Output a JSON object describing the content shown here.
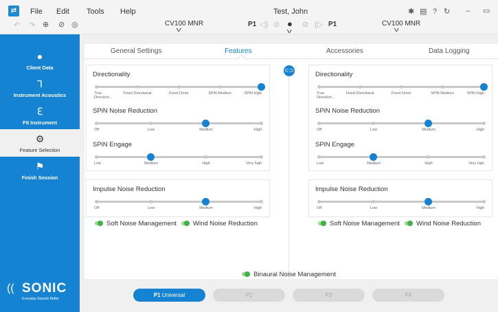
{
  "menu": {
    "file": "File",
    "edit": "Edit",
    "tools": "Tools",
    "help": "Help"
  },
  "patient": "Test, John",
  "devices": {
    "left": "CV100 MNR",
    "right": "CV100 MNR"
  },
  "program_indicator": {
    "left": "P1",
    "right": "P1"
  },
  "sidebar": {
    "items": [
      {
        "label": "Client Data"
      },
      {
        "label": "Instrument Acoustics"
      },
      {
        "label": "Fit Instrument"
      },
      {
        "label": "Feature Selection"
      },
      {
        "label": "Finish Session"
      }
    ],
    "logo": {
      "name": "SONIC",
      "tagline": "Everyday Sounds Better"
    }
  },
  "tabs": [
    {
      "label": "General Settings"
    },
    {
      "label": "Features"
    },
    {
      "label": "Accessories"
    },
    {
      "label": "Data Logging"
    }
  ],
  "active_tab": "Features",
  "sections": {
    "directionality": {
      "title": "Directionality",
      "labels": [
        "True Direction...",
        "Fixed Directional",
        "Fixed Omni",
        "SPiN Medium",
        "SPiN High"
      ]
    },
    "spin_noise": {
      "title": "SPiN Noise Reduction",
      "labels": [
        "Off",
        "Low",
        "Medium",
        "High"
      ]
    },
    "spin_engage": {
      "title": "SPiN Engage",
      "labels": [
        "Low",
        "Medium",
        "High",
        "Very high"
      ]
    },
    "impulse": {
      "title": "Impulse Noise Reduction",
      "labels": [
        "Off",
        "Low",
        "Medium",
        "High"
      ]
    }
  },
  "left": {
    "directionality_value": "SPiN High",
    "spin_noise_value": "Medium",
    "spin_engage_value": "Medium",
    "impulse_value": "Medium"
  },
  "right": {
    "directionality_value": "SPiN High",
    "spin_noise_value": "Medium",
    "spin_engage_value": "Medium",
    "impulse_value": "Medium"
  },
  "toggles": {
    "soft_noise": "Soft Noise Management",
    "wind_noise": "Wind Noise Reduction",
    "binaural": "Binaural Noise Management"
  },
  "programs": [
    {
      "id": "P1",
      "name": "Universal",
      "active": true
    },
    {
      "id": "P2",
      "name": "",
      "active": false
    },
    {
      "id": "P3",
      "name": "",
      "active": false
    },
    {
      "id": "P4",
      "name": "",
      "active": false
    }
  ],
  "colors": {
    "accent": "#1583d1",
    "toggle_on": "#3fb24a",
    "sidebar_bg": "#1583d1"
  }
}
